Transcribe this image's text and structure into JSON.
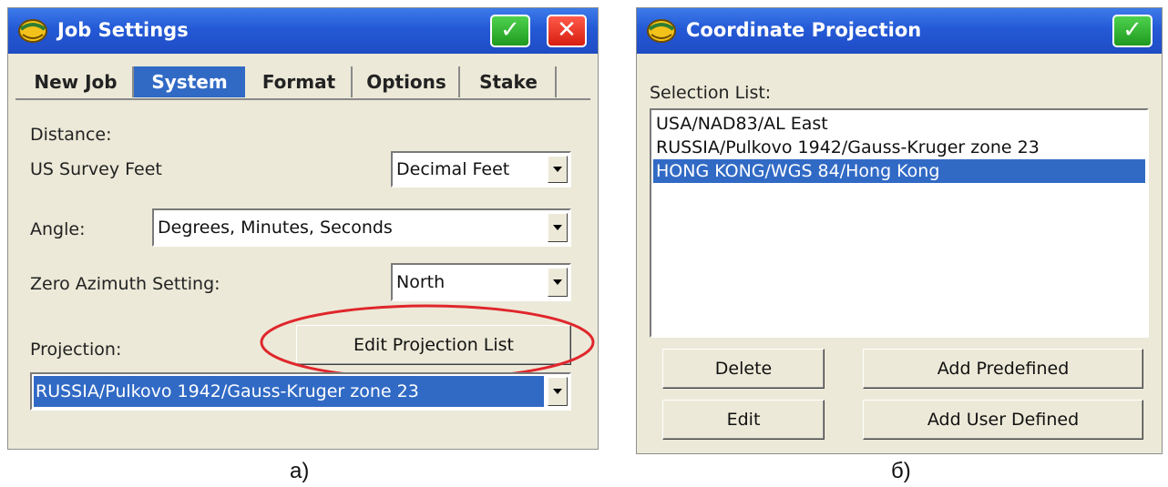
{
  "job_settings": {
    "title": "Job Settings",
    "tabs": [
      {
        "label": "New Job"
      },
      {
        "label": "System"
      },
      {
        "label": "Format"
      },
      {
        "label": "Options"
      },
      {
        "label": "Stake"
      }
    ],
    "selected_tab": "System",
    "distance_label": "Distance:",
    "distance_units_label": "US Survey Feet",
    "distance_value": "Decimal Feet",
    "angle_label": "Angle:",
    "angle_value": "Degrees, Minutes, Seconds",
    "azimuth_label": "Zero Azimuth Setting:",
    "azimuth_value": "North",
    "projection_label": "Projection:",
    "edit_projection_button": "Edit Projection List",
    "projection_value": "RUSSIA/Pulkovo 1942/Gauss-Kruger zone 23",
    "highlight_color": "#e0262c"
  },
  "coordinate_projection": {
    "title": "Coordinate Projection",
    "selection_list_label": "Selection List:",
    "items": [
      {
        "label": "USA/NAD83/AL East",
        "selected": false
      },
      {
        "label": "RUSSIA/Pulkovo 1942/Gauss-Kruger zone 23",
        "selected": false
      },
      {
        "label": "HONG KONG/WGS 84/Hong Kong",
        "selected": true
      }
    ],
    "delete_button": "Delete",
    "add_predefined_button": "Add Predefined",
    "edit_button": "Edit",
    "add_user_defined_button": "Add User Defined"
  },
  "captions": {
    "left": "a)",
    "right": "б)"
  },
  "colors": {
    "titlebar": "#2459d6",
    "selection": "#316ac5",
    "dialog_bg": "#ece9d8",
    "ok_button": "#2db52d",
    "cancel_button": "#e0261a"
  }
}
